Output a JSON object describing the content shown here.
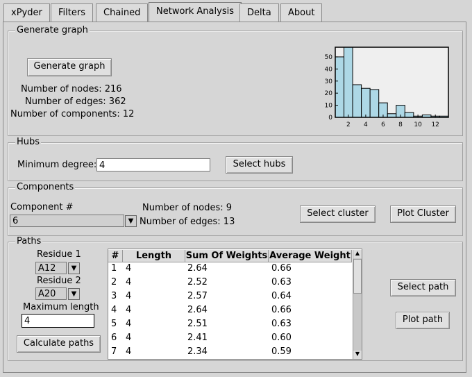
{
  "tabs": [
    {
      "label": "xPyder"
    },
    {
      "label": "Filters"
    },
    {
      "label": "Chained"
    },
    {
      "label": "Network Analysis"
    },
    {
      "label": "Delta"
    },
    {
      "label": "About"
    }
  ],
  "generate": {
    "title": "Generate graph",
    "button": "Generate graph",
    "nodes": "Number of nodes: 216",
    "edges": "Number of edges: 362",
    "components": "Number of components: 12"
  },
  "hubs": {
    "title": "Hubs",
    "min_degree_label": "Minimum degree:",
    "min_degree_value": "4",
    "button": "Select hubs"
  },
  "components": {
    "title": "Components",
    "component_label": "Component #",
    "component_value": "6",
    "nodes": "Number of nodes: 9",
    "edges": "Number of edges: 13",
    "select_button": "Select cluster",
    "plot_button": "Plot Cluster"
  },
  "paths": {
    "title": "Paths",
    "residue1_label": "Residue 1",
    "residue1_value": "A12",
    "residue2_label": "Residue 2",
    "residue2_value": "A20",
    "max_length_label": "Maximum length",
    "max_length_value": "4",
    "calc_button": "Calculate paths",
    "select_button": "Select path",
    "plot_button": "Plot path",
    "columns": [
      "#",
      "Length",
      "Sum Of Weights",
      "Average Weight"
    ],
    "rows": [
      [
        "1",
        "4",
        "2.64",
        "0.66"
      ],
      [
        "2",
        "4",
        "2.52",
        "0.63"
      ],
      [
        "3",
        "4",
        "2.57",
        "0.64"
      ],
      [
        "4",
        "4",
        "2.64",
        "0.66"
      ],
      [
        "5",
        "4",
        "2.51",
        "0.63"
      ],
      [
        "6",
        "4",
        "2.41",
        "0.60"
      ],
      [
        "7",
        "4",
        "2.34",
        "0.59"
      ]
    ]
  },
  "chart_data": {
    "type": "bar",
    "x": [
      1,
      2,
      3,
      4,
      5,
      6,
      7,
      8,
      9,
      10,
      11,
      12,
      13
    ],
    "values": [
      50,
      58,
      27,
      24,
      23,
      12,
      3,
      10,
      4,
      1,
      2,
      1,
      1
    ],
    "xlim": [
      0.5,
      13.5
    ],
    "ylim": [
      0,
      58
    ],
    "xticks": [
      "2",
      "4",
      "6",
      "8",
      "10",
      "12"
    ],
    "yticks": [
      "0",
      "10",
      "20",
      "30",
      "40",
      "50"
    ],
    "bar_color": "#add8e6",
    "background": "#efefef",
    "title": "",
    "xlabel": "",
    "ylabel": ""
  }
}
